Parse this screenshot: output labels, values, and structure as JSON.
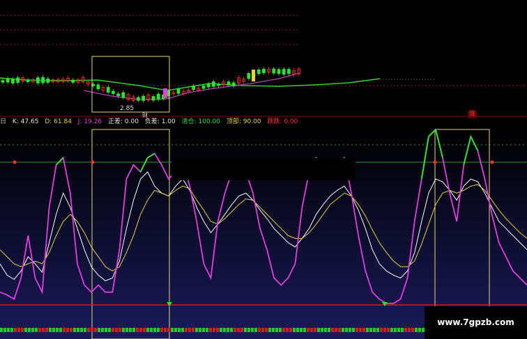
{
  "indicator_bar": {
    "prefix": "日",
    "k": "K: 47.65",
    "d": "D: 61.84",
    "j": "J: 19.26",
    "zheng_cha": "正差: 0.00",
    "fu_cha": "负差: 1.00",
    "qing_cang": "清仓: 100.00",
    "ding_bu": "顶部: 90.00",
    "die_die": "跌跌: 0.00"
  },
  "price_label": "2.85",
  "cai_label": "财",
  "zhang_badge": "涨",
  "watermark": "www.7gpzb.com",
  "colors": {
    "background": "#000000",
    "k_line": "#ffffff",
    "d_line": "#e6d23c",
    "j_line": "#e040e0",
    "j_high": "#30e030",
    "ma_green": "#30d030",
    "ma_magenta": "#c040c0",
    "ref_line": "#2aa02a",
    "highlight_box": "#e6d878",
    "up": "#ff3030",
    "down": "#30e030"
  },
  "chart_data": {
    "type": "line",
    "title": "",
    "xlabel": "",
    "ylabel": "",
    "x": [
      0,
      1,
      2,
      3,
      4,
      5,
      6,
      7,
      8,
      9,
      10,
      11,
      12,
      13,
      14,
      15,
      16,
      17,
      18,
      19,
      20,
      21,
      22,
      23,
      24,
      25,
      26,
      27,
      28,
      29,
      30,
      31,
      32,
      33,
      34,
      35,
      36,
      37,
      38,
      39,
      40,
      41,
      42,
      43,
      44,
      45,
      46,
      47,
      48,
      49,
      50,
      51,
      52,
      53,
      54,
      55,
      56,
      57,
      58,
      59,
      60,
      61,
      62,
      63,
      64,
      65,
      66,
      67,
      68,
      69,
      70,
      71,
      72,
      73,
      74,
      75
    ],
    "ylim": [
      -10,
      115
    ],
    "series": [
      {
        "name": "K",
        "values": [
          20,
          12,
          9,
          15,
          25,
          20,
          14,
          35,
          55,
          70,
          60,
          45,
          30,
          18,
          12,
          8,
          10,
          22,
          45,
          65,
          80,
          85,
          75,
          70,
          68,
          75,
          80,
          72,
          60,
          50,
          42,
          48,
          55,
          62,
          68,
          70,
          65,
          58,
          52,
          45,
          40,
          35,
          32,
          38,
          45,
          55,
          62,
          68,
          72,
          75,
          68,
          58,
          45,
          30,
          20,
          15,
          12,
          10,
          15,
          28,
          50,
          70,
          80,
          78,
          72,
          65,
          75,
          80,
          78,
          70,
          60,
          50,
          45,
          40,
          35,
          30
        ]
      },
      {
        "name": "D",
        "values": [
          30,
          25,
          20,
          18,
          20,
          22,
          20,
          28,
          40,
          50,
          55,
          50,
          42,
          32,
          25,
          18,
          15,
          18,
          28,
          40,
          55,
          65,
          72,
          70,
          68,
          72,
          75,
          73,
          65,
          58,
          50,
          48,
          52,
          57,
          62,
          66,
          65,
          60,
          55,
          50,
          45,
          40,
          38,
          38,
          42,
          48,
          55,
          62,
          66,
          70,
          68,
          62,
          54,
          44,
          35,
          28,
          22,
          18,
          18,
          22,
          34,
          48,
          62,
          70,
          72,
          70,
          72,
          75,
          76,
          72,
          65,
          58,
          52,
          47,
          42,
          38
        ]
      },
      {
        "name": "J",
        "values": [
          0,
          -2,
          -5,
          10,
          40,
          10,
          0,
          60,
          90,
          95,
          70,
          20,
          5,
          0,
          5,
          0,
          0,
          30,
          80,
          90,
          85,
          95,
          98,
          90,
          80,
          85,
          92,
          75,
          50,
          20,
          10,
          50,
          70,
          85,
          90,
          85,
          70,
          45,
          30,
          10,
          5,
          10,
          20,
          60,
          85,
          95,
          90,
          80,
          90,
          95,
          70,
          40,
          15,
          0,
          -5,
          -8,
          -8,
          -5,
          10,
          50,
          80,
          110,
          115,
          95,
          70,
          50,
          90,
          110,
          100,
          80,
          55,
          35,
          25,
          15,
          10,
          5
        ]
      }
    ]
  }
}
